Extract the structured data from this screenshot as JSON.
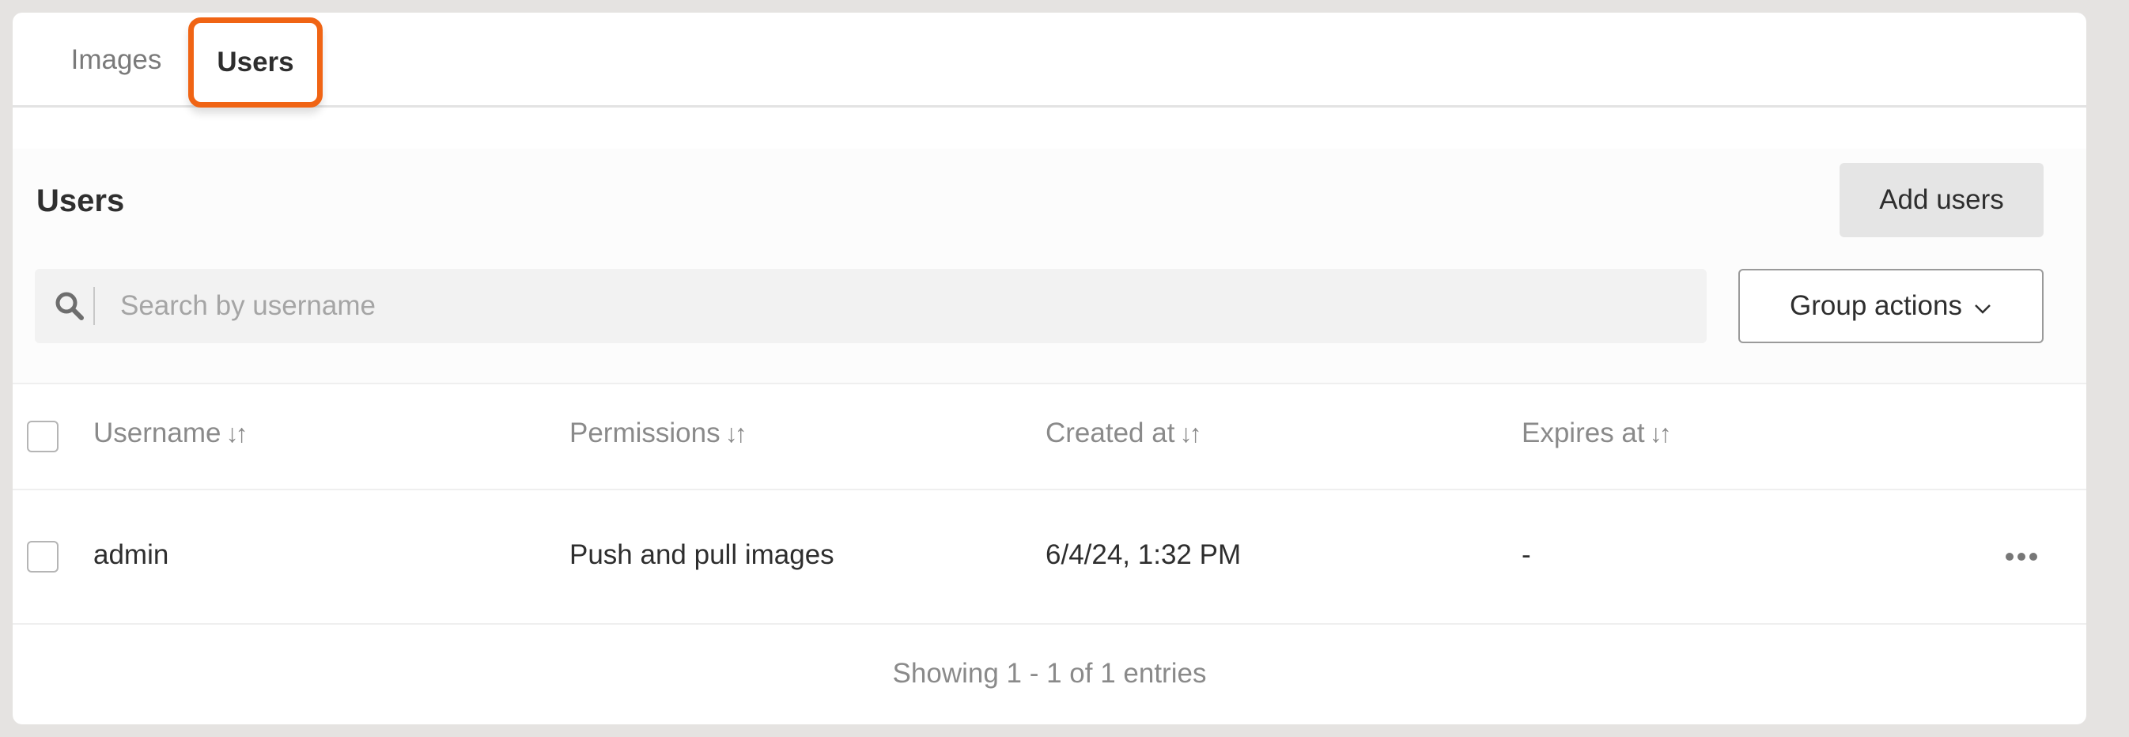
{
  "tabs": [
    {
      "label": "Images",
      "active": false
    },
    {
      "label": "Users",
      "active": true
    }
  ],
  "header": {
    "title": "Users",
    "add_button": "Add users"
  },
  "search": {
    "placeholder": "Search by username",
    "value": ""
  },
  "group_actions": {
    "label": "Group actions"
  },
  "table": {
    "columns": [
      {
        "label": "Username",
        "sort_icon": "↓↑"
      },
      {
        "label": "Permissions",
        "sort_icon": "↓↑"
      },
      {
        "label": "Created at",
        "sort_icon": "↓↑"
      },
      {
        "label": "Expires at",
        "sort_icon": "↓↑"
      }
    ],
    "rows": [
      {
        "username": "admin",
        "permissions": "Push and pull images",
        "created_at": "6/4/24, 1:32 PM",
        "expires_at": "-"
      }
    ]
  },
  "footer": {
    "text": "Showing 1 - 1 of 1 entries"
  },
  "colors": {
    "accent_highlight": "#f06414",
    "background": "#e5e3e1"
  },
  "icons": {
    "search": "search-icon",
    "chevron": "chevron-down-icon",
    "sort": "sort-icon",
    "more": "more-horizontal-icon"
  }
}
